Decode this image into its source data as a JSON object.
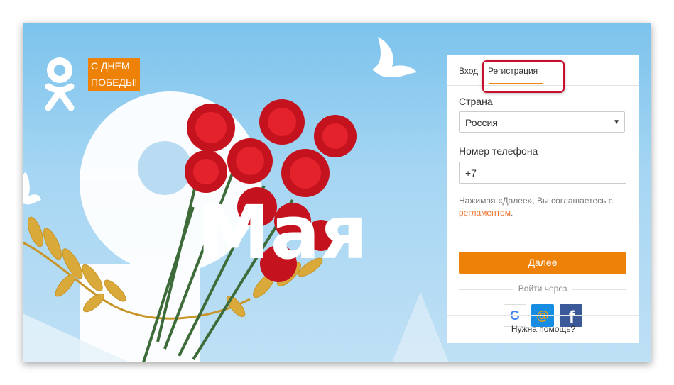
{
  "banner": {
    "line1": "С ДНЕМ",
    "line2": "ПОБЕДЫ!"
  },
  "hero": {
    "big_number": "9",
    "big_word": "Мая"
  },
  "tabs": {
    "login": "Вход",
    "register": "Регистрация",
    "active": "register"
  },
  "form": {
    "country_label": "Страна",
    "country_value": "Россия",
    "phone_label": "Номер телефона",
    "phone_value": "+7",
    "terms_text": "Нажимая «Далее», Вы соглашаетесь с",
    "terms_link": "регламентом",
    "terms_end": ".",
    "submit_label": "Далее"
  },
  "social": {
    "divider_text": "Войти через",
    "providers": [
      {
        "name": "google",
        "icon": "google-icon",
        "glyph": "G"
      },
      {
        "name": "mail.ru",
        "icon": "mailru-icon",
        "glyph": "@"
      },
      {
        "name": "facebook",
        "icon": "facebook-icon",
        "glyph": "f"
      }
    ]
  },
  "help_link": "Нужна помощь?",
  "colors": {
    "accent": "#ee8208",
    "link": "#eb722e",
    "highlight": "#c8102e",
    "sky": "#8ccbef"
  }
}
